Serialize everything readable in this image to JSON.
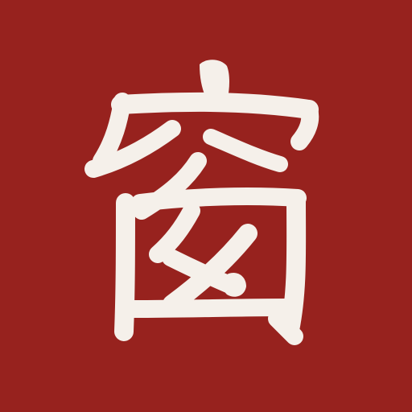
{
  "icon": {
    "name": "app-icon",
    "glyph": "窗",
    "background_color": "#97221e",
    "glyph_color": "#f5f0ea"
  }
}
